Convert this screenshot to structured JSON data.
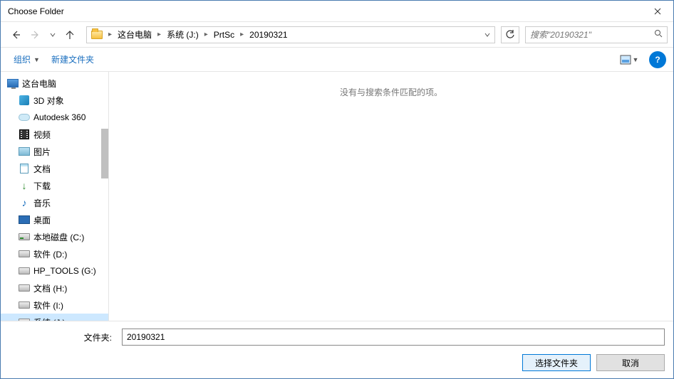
{
  "window": {
    "title": "Choose Folder"
  },
  "breadcrumb": {
    "items": [
      "这台电脑",
      "系统 (J:)",
      "PrtSc",
      "20190321"
    ]
  },
  "search": {
    "placeholder": "搜索\"20190321\""
  },
  "toolbar": {
    "organize_label": "组织",
    "newfolder_label": "新建文件夹"
  },
  "sidebar": {
    "items": [
      {
        "label": "这台电脑",
        "icon": "monitor",
        "indent": 0
      },
      {
        "label": "3D 对象",
        "icon": "3d",
        "indent": 1
      },
      {
        "label": "Autodesk 360",
        "icon": "cloud",
        "indent": 1
      },
      {
        "label": "视频",
        "icon": "video",
        "indent": 1
      },
      {
        "label": "图片",
        "icon": "pic",
        "indent": 1
      },
      {
        "label": "文档",
        "icon": "doc",
        "indent": 1
      },
      {
        "label": "下载",
        "icon": "download",
        "indent": 1
      },
      {
        "label": "音乐",
        "icon": "music",
        "indent": 1
      },
      {
        "label": "桌面",
        "icon": "desktop",
        "indent": 1
      },
      {
        "label": "本地磁盘 (C:)",
        "icon": "disk-c",
        "indent": 1
      },
      {
        "label": "软件 (D:)",
        "icon": "disk",
        "indent": 1
      },
      {
        "label": "HP_TOOLS (G:)",
        "icon": "disk",
        "indent": 1
      },
      {
        "label": "文档 (H:)",
        "icon": "disk",
        "indent": 1
      },
      {
        "label": "软件 (I:)",
        "icon": "disk",
        "indent": 1
      },
      {
        "label": "系统 (J:)",
        "icon": "disk",
        "indent": 1,
        "selected": true
      }
    ]
  },
  "content": {
    "empty_message": "没有与搜索条件匹配的项。"
  },
  "footer": {
    "folder_label": "文件夹:",
    "folder_value": "20190321",
    "select_label": "选择文件夹",
    "cancel_label": "取消"
  }
}
